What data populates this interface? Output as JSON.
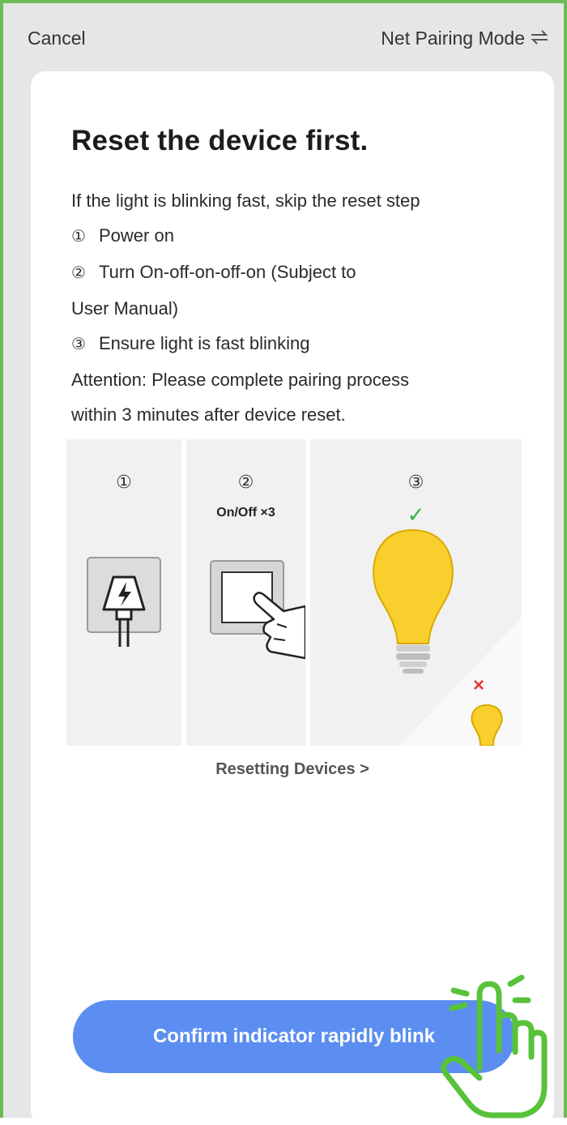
{
  "header": {
    "cancel_label": "Cancel",
    "mode_label": "Net Pairing Mode",
    "mode_icon": "swap-arrows-icon"
  },
  "main": {
    "title": "Reset the device first.",
    "intro": "If the light is blinking fast, skip the reset step",
    "steps": [
      {
        "num": "①",
        "text": "Power on"
      },
      {
        "num": "②",
        "text": "Turn On-off-on-off-on (Subject to"
      },
      {
        "num": "",
        "text": "User Manual)"
      },
      {
        "num": "③",
        "text": "Ensure light is fast blinking"
      }
    ],
    "attention_line1": "Attention: Please complete pairing process",
    "attention_line2": "within 3 minutes after device reset."
  },
  "illustration": {
    "panels": [
      {
        "num": "①",
        "icon": "power-plug-icon"
      },
      {
        "num": "②",
        "caption": "On/Off ×3",
        "icon": "switch-press-icon"
      },
      {
        "num": "③",
        "icon": "bulb-icon",
        "check": "✓",
        "cross": "×"
      }
    ],
    "colors": {
      "bulb": "#f9cf2d",
      "check": "#2bb24c",
      "cross": "#e53935"
    }
  },
  "reset_link": "Resetting Devices >",
  "confirm_button": {
    "label": "Confirm indicator rapidly blink",
    "color": "#5b8ef0",
    "overlay_icon": "tap-hand-icon",
    "overlay_color": "#58c23a"
  }
}
